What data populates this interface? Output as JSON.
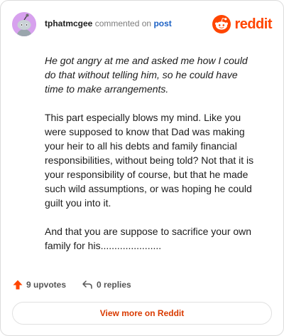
{
  "header": {
    "username": "tphatmcgee",
    "action_text": "commented on",
    "post_link": "post",
    "brand_text": "reddit",
    "avatar_color": "#d7a1ee",
    "brand_color": "#ff4500",
    "link_color": "#1c61c4"
  },
  "comment": {
    "quote": "He got angry at me and asked me how I could do that without telling him, so he could have time to make arrangements.",
    "paragraphs": [
      "This part especially blows my mind. Like you were supposed to know that Dad was making your heir to all his debts and family financial responsibilities, without being told? Not that it is your responsibility of course, but that he made such wild assumptions, or was hoping he could guilt you into it.",
      "And that you are suppose to sacrifice your own family for his......................"
    ]
  },
  "footer": {
    "upvotes_label": "9 upvotes",
    "replies_label": "0 replies",
    "upvote_icon": "upvote-arrow-icon",
    "reply_icon": "reply-arrow-icon",
    "upvote_color": "#ff4500"
  },
  "view_more_label": "View more on Reddit",
  "view_more_color": "#d93a00"
}
